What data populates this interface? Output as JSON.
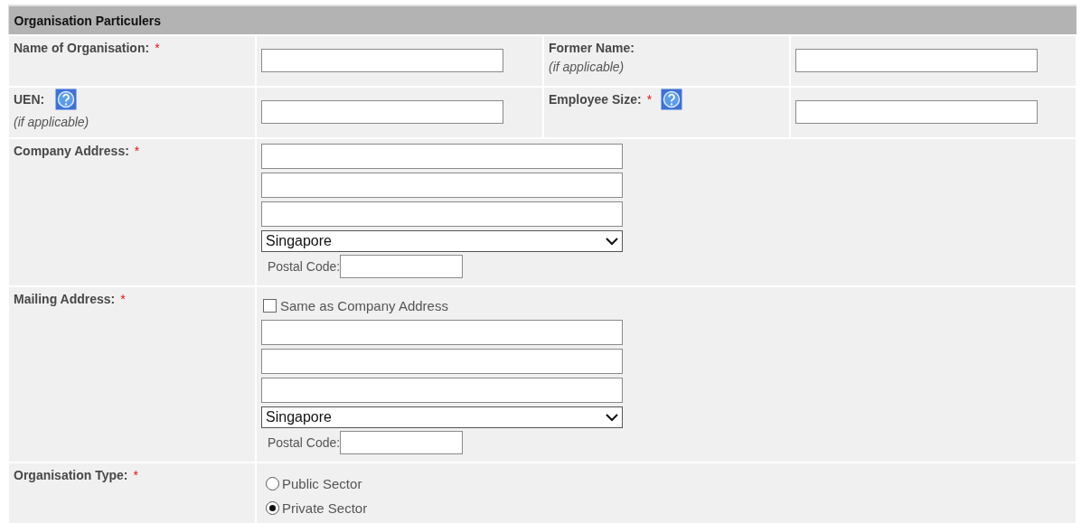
{
  "section": {
    "title": "Organisation Particulers"
  },
  "pair_rows": [
    {
      "left": {
        "label": "Name of Organisation:",
        "required_mark": "*"
      },
      "right": {
        "label": "Former Name:",
        "hint": "(if applicable)"
      }
    },
    {
      "left": {
        "label": "UEN:",
        "help": true,
        "hint": "(if applicable)"
      },
      "right": {
        "label": "Employee Size:",
        "required_mark": "*",
        "help": true
      }
    }
  ],
  "company_address": {
    "label": "Company Address:",
    "required_mark": "*",
    "country": "Singapore",
    "postal_label": "Postal Code:"
  },
  "mailing_address": {
    "label": "Mailing Address:",
    "required_mark": "*",
    "same_as": {
      "label": "Same as Company Address",
      "checked": false
    },
    "country": "Singapore",
    "postal_label": "Postal Code:"
  },
  "organisation_type": {
    "label": "Organisation Type:",
    "required_mark": "*",
    "options": [
      {
        "label": "Public Sector",
        "selected": false
      },
      {
        "label": "Private Sector",
        "selected": true
      }
    ]
  }
}
